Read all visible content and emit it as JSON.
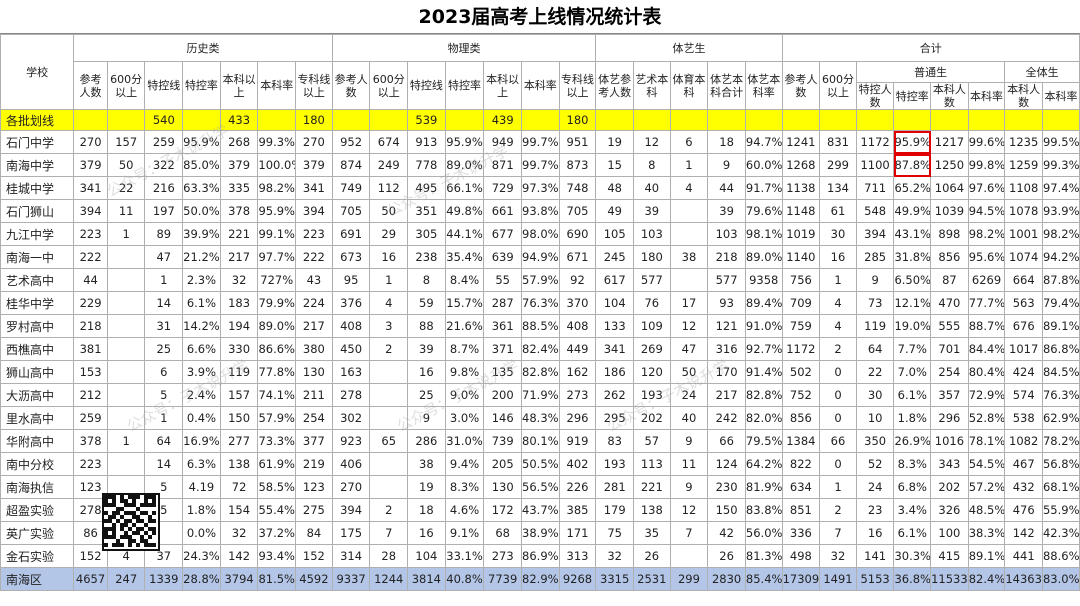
{
  "title": "2023届高考上线情况统计表",
  "headers": {
    "school": "学校",
    "groups": [
      "历史类",
      "物理类",
      "体艺生",
      "合计"
    ],
    "hist": [
      "参考人数",
      "600分以上",
      "特控线",
      "特控率",
      "本科以上",
      "本科率",
      "专科线以上"
    ],
    "phys": [
      "参考人数",
      "600分以上",
      "特控线",
      "特控率",
      "本科以上",
      "本科率",
      "专科线以上"
    ],
    "art": [
      "体艺参考人数",
      "艺术本科",
      "体育本科",
      "体艺本科合计",
      "体艺本科率"
    ],
    "total_head": [
      "参考人数",
      "600分以上"
    ],
    "general_group": "普通生",
    "general": [
      "特控人数",
      "特控率",
      "本科人数",
      "本科率"
    ],
    "all_group": "全体生",
    "all": [
      "本科人数",
      "本科率"
    ]
  },
  "ref_row": {
    "label": "各批划线",
    "hist_tekong": "540",
    "hist_benke": "433",
    "hist_zhuanke": "180",
    "phys_tekong": "539",
    "phys_benke": "439",
    "phys_zhuanke": "180"
  },
  "rows": [
    [
      "石门中学",
      "270",
      "157",
      "259",
      "95.9%",
      "268",
      "99.3%",
      "270",
      "952",
      "674",
      "913",
      "95.9%",
      "949",
      "99.7%",
      "951",
      "19",
      "12",
      "6",
      "18",
      "94.7%",
      "1241",
      "831",
      "1172",
      "95.9%",
      "1217",
      "99.6%",
      "1235",
      "99.5%"
    ],
    [
      "南海中学",
      "379",
      "50",
      "322",
      "85.0%",
      "379",
      "100.0%",
      "379",
      "874",
      "249",
      "778",
      "89.0%",
      "871",
      "99.7%",
      "873",
      "15",
      "8",
      "1",
      "9",
      "60.0%",
      "1268",
      "299",
      "1100",
      "87.8%",
      "1250",
      "99.8%",
      "1259",
      "99.3%"
    ],
    [
      "桂城中学",
      "341",
      "22",
      "216",
      "63.3%",
      "335",
      "98.2%",
      "341",
      "749",
      "112",
      "495",
      "66.1%",
      "729",
      "97.3%",
      "748",
      "48",
      "40",
      "4",
      "44",
      "91.7%",
      "1138",
      "134",
      "711",
      "65.2%",
      "1064",
      "97.6%",
      "1108",
      "97.4%"
    ],
    [
      "石门狮山",
      "394",
      "11",
      "197",
      "50.0%",
      "378",
      "95.9%",
      "394",
      "705",
      "50",
      "351",
      "49.8%",
      "661",
      "93.8%",
      "705",
      "49",
      "39",
      "",
      "39",
      "79.6%",
      "1148",
      "61",
      "548",
      "49.9%",
      "1039",
      "94.5%",
      "1078",
      "93.9%"
    ],
    [
      "九江中学",
      "223",
      "1",
      "89",
      "39.9%",
      "221",
      "99.1%",
      "223",
      "691",
      "29",
      "305",
      "44.1%",
      "677",
      "98.0%",
      "690",
      "105",
      "103",
      "",
      "103",
      "98.1%",
      "1019",
      "30",
      "394",
      "43.1%",
      "898",
      "98.2%",
      "1001",
      "98.2%"
    ],
    [
      "南海一中",
      "222",
      "",
      "47",
      "21.2%",
      "217",
      "97.7%",
      "222",
      "673",
      "16",
      "238",
      "35.4%",
      "639",
      "94.9%",
      "671",
      "245",
      "180",
      "38",
      "218",
      "89.0%",
      "1140",
      "16",
      "285",
      "31.8%",
      "856",
      "95.6%",
      "1074",
      "94.2%"
    ],
    [
      "艺术高中",
      "44",
      "",
      "1",
      "2.3%",
      "32",
      "727%",
      "43",
      "95",
      "1",
      "8",
      "8.4%",
      "55",
      "57.9%",
      "92",
      "617",
      "577",
      "",
      "577",
      "9358",
      "756",
      "1",
      "9",
      "6.50%",
      "87",
      "6269",
      "664",
      "87.8%"
    ],
    [
      "桂华中学",
      "229",
      "",
      "14",
      "6.1%",
      "183",
      "79.9%",
      "224",
      "376",
      "4",
      "59",
      "15.7%",
      "287",
      "76.3%",
      "370",
      "104",
      "76",
      "17",
      "93",
      "89.4%",
      "709",
      "4",
      "73",
      "12.1%",
      "470",
      "77.7%",
      "563",
      "79.4%"
    ],
    [
      "罗村高中",
      "218",
      "",
      "31",
      "14.2%",
      "194",
      "89.0%",
      "217",
      "408",
      "3",
      "88",
      "21.6%",
      "361",
      "88.5%",
      "408",
      "133",
      "109",
      "12",
      "121",
      "91.0%",
      "759",
      "4",
      "119",
      "19.0%",
      "555",
      "88.7%",
      "676",
      "89.1%"
    ],
    [
      "西樵高中",
      "381",
      "",
      "25",
      "6.6%",
      "330",
      "86.6%",
      "380",
      "450",
      "2",
      "39",
      "8.7%",
      "371",
      "82.4%",
      "449",
      "341",
      "269",
      "47",
      "316",
      "92.7%",
      "1172",
      "2",
      "64",
      "7.7%",
      "701",
      "84.4%",
      "1017",
      "86.8%"
    ],
    [
      "狮山高中",
      "153",
      "",
      "6",
      "3.9%",
      "119",
      "77.8%",
      "130",
      "163",
      "",
      "16",
      "9.8%",
      "135",
      "82.8%",
      "162",
      "186",
      "120",
      "50",
      "170",
      "91.4%",
      "502",
      "0",
      "22",
      "7.0%",
      "254",
      "80.4%",
      "424",
      "84.5%"
    ],
    [
      "大沥高中",
      "212",
      "",
      "5",
      "2.4%",
      "157",
      "74.1%",
      "211",
      "278",
      "",
      "25",
      "9.0%",
      "200",
      "71.9%",
      "273",
      "262",
      "193",
      "24",
      "217",
      "82.8%",
      "752",
      "0",
      "30",
      "6.1%",
      "357",
      "72.9%",
      "574",
      "76.3%"
    ],
    [
      "里水高中",
      "259",
      "",
      "1",
      "0.4%",
      "150",
      "57.9%",
      "254",
      "302",
      "",
      "9",
      "3.0%",
      "146",
      "48.3%",
      "296",
      "295",
      "202",
      "40",
      "242",
      "82.0%",
      "856",
      "0",
      "10",
      "1.8%",
      "296",
      "52.8%",
      "538",
      "62.9%"
    ],
    [
      "华附高中",
      "378",
      "1",
      "64",
      "16.9%",
      "277",
      "73.3%",
      "377",
      "923",
      "65",
      "286",
      "31.0%",
      "739",
      "80.1%",
      "919",
      "83",
      "57",
      "9",
      "66",
      "79.5%",
      "1384",
      "66",
      "350",
      "26.9%",
      "1016",
      "78.1%",
      "1082",
      "78.2%"
    ],
    [
      "南中分校",
      "223",
      "",
      "14",
      "6.3%",
      "138",
      "61.9%",
      "219",
      "406",
      "",
      "38",
      "9.4%",
      "205",
      "50.5%",
      "402",
      "193",
      "113",
      "11",
      "124",
      "64.2%",
      "822",
      "0",
      "52",
      "8.3%",
      "343",
      "54.5%",
      "467",
      "56.8%"
    ],
    [
      "南海执信",
      "123",
      "",
      "5",
      "4.19",
      "72",
      "58.5%",
      "123",
      "270",
      "",
      "19",
      "8.3%",
      "130",
      "56.5%",
      "226",
      "281",
      "221",
      "9",
      "230",
      "81.9%",
      "634",
      "1",
      "24",
      "6.8%",
      "202",
      "57.2%",
      "432",
      "68.1%"
    ],
    [
      "超盈实验",
      "278",
      "",
      "5",
      "1.8%",
      "154",
      "55.4%",
      "275",
      "394",
      "2",
      "18",
      "4.6%",
      "172",
      "43.7%",
      "385",
      "179",
      "138",
      "12",
      "150",
      "83.8%",
      "851",
      "2",
      "23",
      "3.4%",
      "326",
      "48.5%",
      "476",
      "55.9%"
    ],
    [
      "英广实验",
      "86",
      "",
      "",
      "0.0%",
      "32",
      "37.2%",
      "84",
      "175",
      "7",
      "16",
      "9.1%",
      "68",
      "38.9%",
      "171",
      "75",
      "35",
      "7",
      "42",
      "56.0%",
      "336",
      "7",
      "16",
      "6.1%",
      "100",
      "38.3%",
      "142",
      "42.3%"
    ],
    [
      "金石实验",
      "152",
      "4",
      "37",
      "24.3%",
      "142",
      "93.4%",
      "152",
      "314",
      "28",
      "104",
      "33.1%",
      "273",
      "86.9%",
      "313",
      "32",
      "26",
      "",
      "26",
      "81.3%",
      "498",
      "32",
      "141",
      "30.3%",
      "415",
      "89.1%",
      "441",
      "88.6%"
    ]
  ],
  "total_row": [
    "南海区",
    "4657",
    "247",
    "1339",
    "28.8%",
    "3794",
    "81.5%",
    "4592",
    "9337",
    "1244",
    "3814",
    "40.8%",
    "7739",
    "82.9%",
    "9268",
    "3315",
    "2531",
    "299",
    "2830",
    "85.4%",
    "17309",
    "1491",
    "5153",
    "36.8%",
    "11533",
    "82.4%",
    "14363",
    "83.0%"
  ],
  "watermark_text": "公众号：子木说升学",
  "highlight_color": "#e00000",
  "ref_row_color": "#ffff00",
  "total_row_color": "#b4c6e7"
}
